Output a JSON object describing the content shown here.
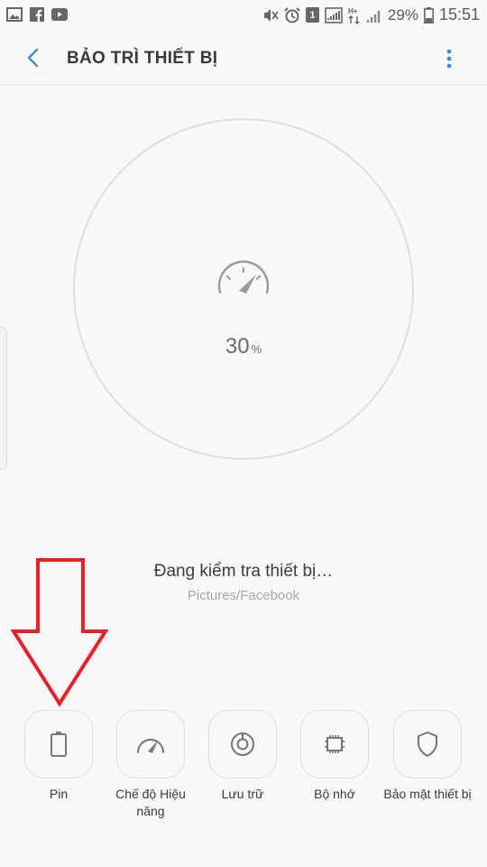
{
  "status_bar": {
    "left_icons": [
      "image-icon",
      "facebook-icon",
      "youtube-icon"
    ],
    "right_icons": [
      "mute-icon",
      "alarm-icon",
      "sim1-icon",
      "signal-icon",
      "hd-lte-icon",
      "signal-icon",
      "battery-icon"
    ],
    "sim_label": "1",
    "battery_percent": "29%",
    "time": "15:51"
  },
  "appbar": {
    "title": "BẢO TRÌ THIẾT BỊ",
    "back_icon": "chevron-left-icon",
    "more_icon": "more-vertical-icon"
  },
  "progress": {
    "value": "30",
    "unit": "%",
    "icon": "speedometer-icon"
  },
  "scan": {
    "status": "Đang kiểm tra thiết bị…",
    "path": "Pictures/Facebook"
  },
  "tools": [
    {
      "label": "Pin",
      "icon": "battery-icon"
    },
    {
      "label": "Chế độ Hiệu năng",
      "icon": "speedometer-icon"
    },
    {
      "label": "Lưu trữ",
      "icon": "storage-icon"
    },
    {
      "label": "Bộ nhớ",
      "icon": "chip-icon"
    },
    {
      "label": "Bảo mật thiết bị",
      "icon": "shield-icon"
    }
  ],
  "colors": {
    "accent": "#3d8fd1",
    "arrow": "#e8202a",
    "background": "#f8f8f8"
  }
}
